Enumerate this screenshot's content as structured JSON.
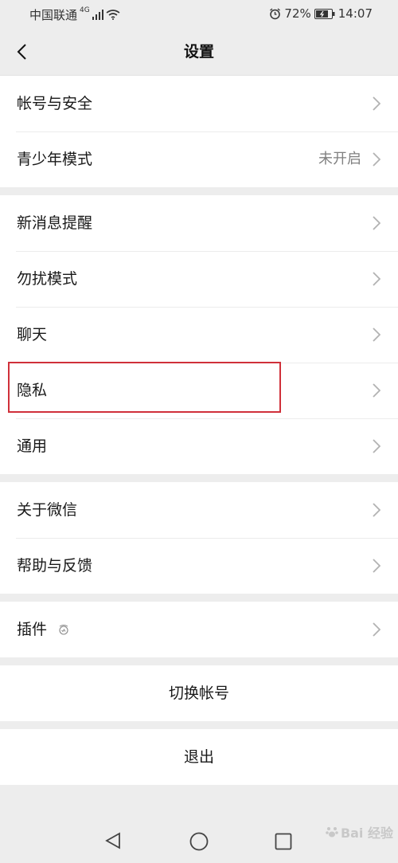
{
  "status_bar": {
    "carrier": "中国联通",
    "network": "4G",
    "battery": "72%",
    "time": "14:07"
  },
  "header": {
    "title": "设置"
  },
  "groups": [
    {
      "items": [
        {
          "label": "帐号与安全",
          "value": ""
        },
        {
          "label": "青少年模式",
          "value": "未开启"
        }
      ]
    },
    {
      "items": [
        {
          "label": "新消息提醒",
          "value": ""
        },
        {
          "label": "勿扰模式",
          "value": ""
        },
        {
          "label": "聊天",
          "value": ""
        },
        {
          "label": "隐私",
          "value": ""
        },
        {
          "label": "通用",
          "value": ""
        }
      ]
    },
    {
      "items": [
        {
          "label": "关于微信",
          "value": ""
        },
        {
          "label": "帮助与反馈",
          "value": ""
        }
      ]
    },
    {
      "items": [
        {
          "label": "插件",
          "value": "",
          "icon": "plugin-badge-icon"
        }
      ]
    }
  ],
  "actions": {
    "switch_account": "切换帐号",
    "logout": "退出"
  },
  "watermark": {
    "text": "Bai 经验"
  },
  "colors": {
    "highlight": "#d0303a",
    "background": "#ededed",
    "secondary_text": "#808080"
  }
}
